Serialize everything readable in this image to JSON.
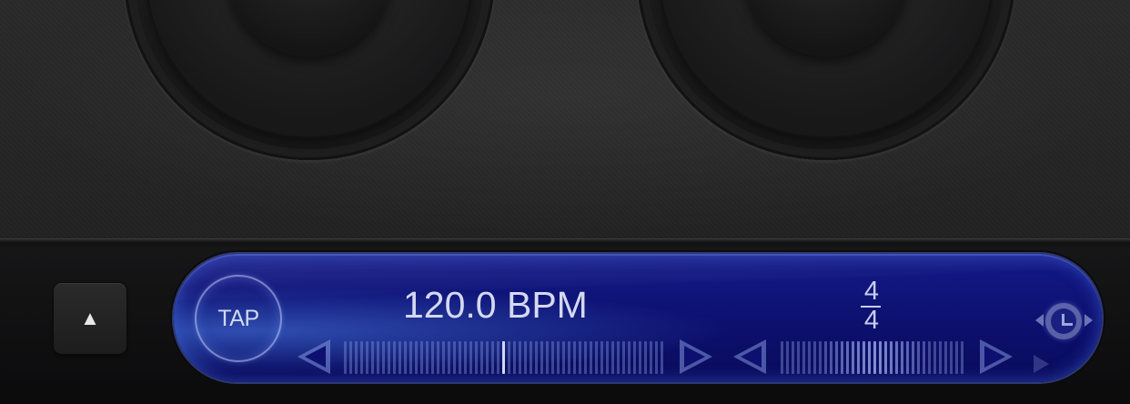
{
  "controls": {
    "up_button_label": "▲",
    "tap_label": "TAP",
    "tempo_display": "120.0 BPM",
    "time_signature": {
      "numerator": "4",
      "denominator": "4"
    },
    "tempo_slider_level": 0.5,
    "signature_slider_level": 0.5
  },
  "colors": {
    "lcd_blue": "#0c0f6c",
    "lcd_text": "#d4d9f1",
    "background": "#1b1b1c"
  },
  "icons": {
    "up": "up-triangle-icon",
    "metronome": "metronome-clock-icon",
    "tempo_down": "left-triangle-outline-icon",
    "tempo_up": "right-triangle-outline-icon"
  }
}
